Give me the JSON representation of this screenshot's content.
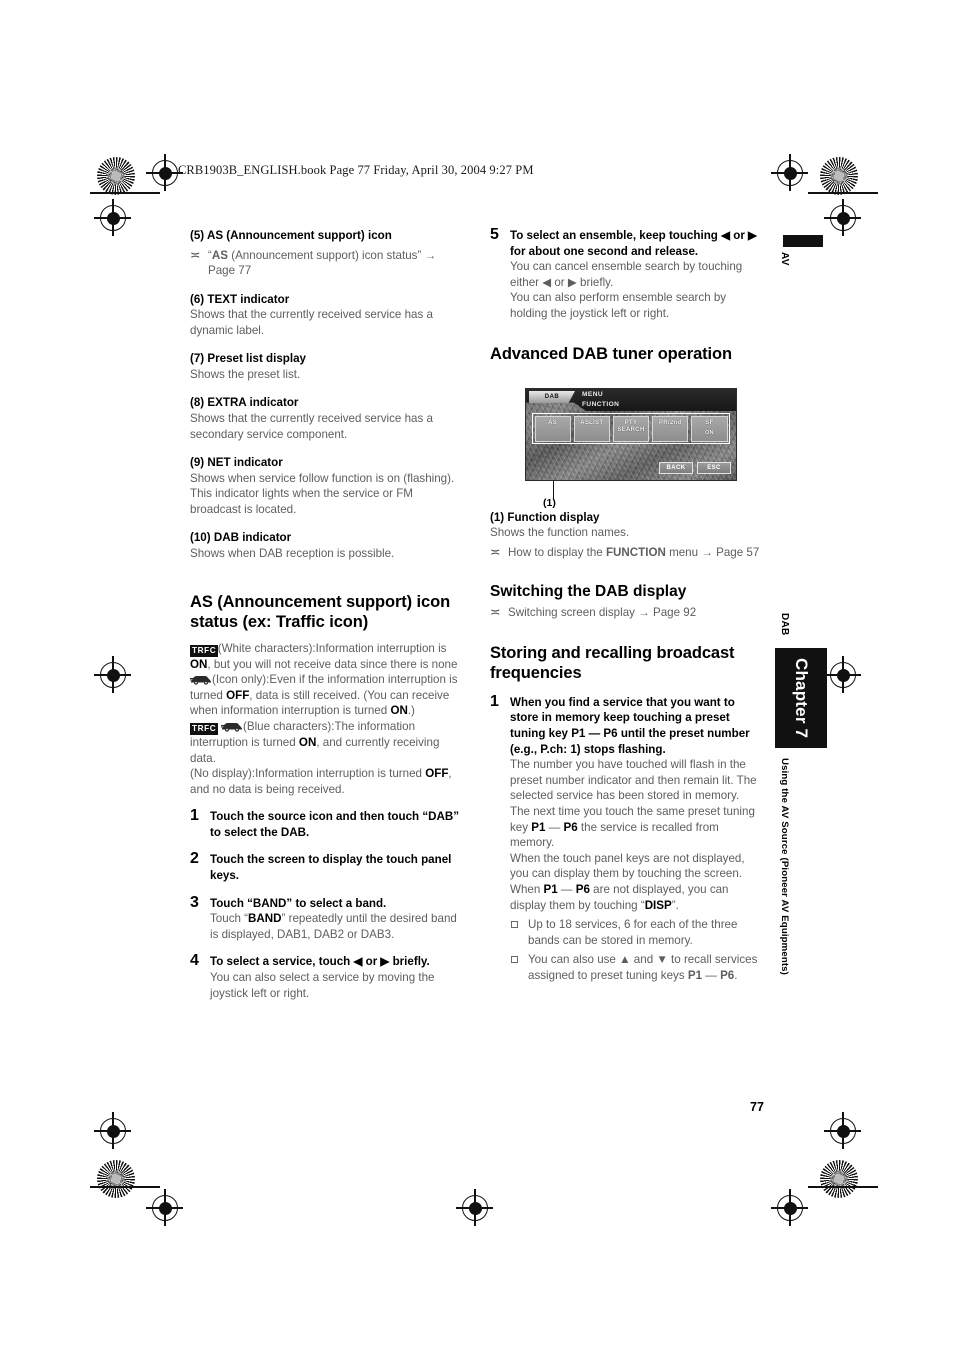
{
  "header": {
    "book_line": "CRB1903B_ENGLISH.book  Page 77  Friday, April 30, 2004  9:27 PM"
  },
  "page_number": "77",
  "sidebar": {
    "top_label": "AV",
    "section_label": "DAB",
    "chapter_label": "Chapter 7",
    "chapter_title": "Using the AV Source (Pioneer AV Equipments)"
  },
  "left_column": {
    "item5_title": "(5) AS (Announcement support) icon",
    "item5_title_bold": "AS",
    "item5_ref": "“AS (Announcement support) icon status” → Page 77",
    "item5_ref_pre": "“",
    "item5_ref_bold": "AS",
    "item5_ref_post": " (Announcement support) icon status” → Page 77",
    "item6_title_num": "(6) ",
    "item6_title_bold": "TEXT",
    "item6_title_rest": " indicator",
    "item6_body": "Shows that the currently received service has a dynamic label.",
    "item7_title": "(7) Preset list display",
    "item7_body": "Shows the preset list.",
    "item8_title_num": "(8) ",
    "item8_title_bold": "EXTRA",
    "item8_title_rest": " indicator",
    "item8_body": "Shows that the currently received service has a secondary service component.",
    "item9_title_num": "(9) ",
    "item9_title_bold": "NET",
    "item9_title_rest": " indicator",
    "item9_body_1": "Shows when service follow function is on (flashing).",
    "item9_body_2": "This indicator lights when the service or FM broadcast is located.",
    "item10_title_num": "(10) ",
    "item10_title_bold": "DAB",
    "item10_title_rest": " indicator",
    "item10_body": "Shows when DAB reception is possible.",
    "heading_as_status": "AS (Announcement support) icon status (ex: Traffic icon)",
    "trfc_icon_label": "TRFC",
    "white_chars_1": "(White characters):Information interruption is ",
    "white_chars_on": "ON",
    "white_chars_2": ", but you will not receive data since there is none",
    "icon_only_1": "(Icon only):Even if the information interruption is turned ",
    "icon_only_off": "OFF",
    "icon_only_2": ", data is still received. (You can receive when information interruption is turned ",
    "icon_only_on": "ON",
    "icon_only_3": ".)",
    "blue_chars_1": "(Blue characters):The information interruption is turned ",
    "blue_chars_on": "ON",
    "blue_chars_2": ", and currently receiving data.",
    "no_display_1": "(No display):Information interruption is turned ",
    "no_display_off": "OFF",
    "no_display_2": ", and no data is being received.",
    "step1_num": "1",
    "step1_lead": "Touch the source icon and then touch “DAB” to select the DAB.",
    "step2_num": "2",
    "step2_lead": "Touch the screen to display the touch panel keys.",
    "step3_num": "3",
    "step3_lead": "Touch “BAND” to select a band.",
    "step3_body_1": "Touch “",
    "step3_body_bold": "BAND",
    "step3_body_2": "” repeatedly until the desired band is displayed, DAB1, DAB2 or DAB3.",
    "step4_num": "4",
    "step4_lead": "To select a service, touch ◀ or ▶ briefly.",
    "step4_body": "You can also select a service by moving the joystick left or right."
  },
  "right_column": {
    "step5_num": "5",
    "step5_lead": "To select an ensemble, keep touching ◀ or ▶ for about one second and release.",
    "step5_body_1": "You can cancel ensemble search by touching either ◀ or ▶ briefly.",
    "step5_body_2": "You can also perform ensemble search by holding the joystick left or right.",
    "heading_advanced": "Advanced DAB tuner operation",
    "figure": {
      "source_label": "DAB",
      "menu_line1": "MENU",
      "menu_line2": "FUNCTION",
      "keys": [
        {
          "label": "AS",
          "sub": ""
        },
        {
          "label": "ASLIST",
          "sub": ""
        },
        {
          "label": "PTY SEARCH",
          "sub": ""
        },
        {
          "label": "PR/2nd",
          "sub": ""
        },
        {
          "label": "SF",
          "sub": "ON"
        }
      ],
      "back_label": "BACK",
      "esc_label": "ESC",
      "callout": "(1)"
    },
    "item1_title": "(1) Function display",
    "item1_body": "Shows the function names.",
    "item1_ref_1": "How to display the ",
    "item1_ref_bold": "FUNCTION",
    "item1_ref_2": " menu → Page 57",
    "heading_switching": "Switching the DAB display",
    "switching_ref": "Switching screen display → Page 92",
    "heading_storing": "Storing and recalling broadcast frequencies",
    "store_step_num": "1",
    "store_step_lead": "When you find a service that you want to store in memory keep touching a preset tuning key P1 — P6 until the preset number (e.g., P.ch: 1) stops flashing.",
    "store_body_1": "The number you have touched will flash in the preset number indicator and then remain lit. The selected service has been stored in memory.",
    "store_body_2_pre": "The next time you touch the same preset tuning key ",
    "store_body_2_b1": "P1",
    "store_body_2_mid": " — ",
    "store_body_2_b2": "P6",
    "store_body_2_post": " the service is recalled from memory.",
    "store_body_3": "When the touch panel keys are not displayed, you can display them by touching the screen.",
    "store_body_4_pre": "When ",
    "store_body_4_b1": "P1",
    "store_body_4_mid": " — ",
    "store_body_4_b2": "P6",
    "store_body_4_post": " are not displayed, you can display them by touching “",
    "store_body_4_disp": "DISP",
    "store_body_4_end": "”.",
    "note1": "Up to 18 services, 6 for each of the three bands can be stored in memory.",
    "note2_pre": "You can also use ▲ and ▼ to recall services assigned to preset tuning keys ",
    "note2_b1": "P1",
    "note2_mid": " — ",
    "note2_b2": "P6",
    "note2_post": "."
  }
}
